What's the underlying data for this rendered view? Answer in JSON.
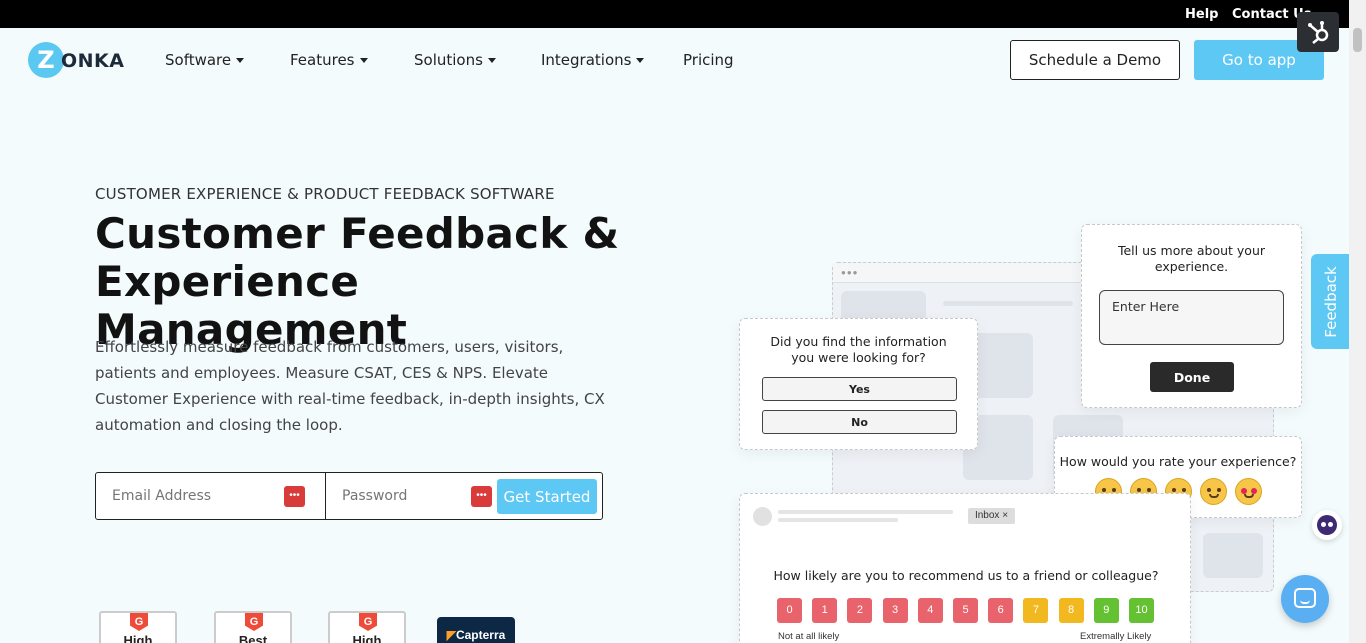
{
  "topbar": {
    "help": "Help",
    "contact": "Contact Us"
  },
  "logo": {
    "mark": "Z",
    "rest": "ONKA"
  },
  "nav": {
    "items": [
      {
        "label": "Software",
        "dropdown": true
      },
      {
        "label": "Features",
        "dropdown": true
      },
      {
        "label": "Solutions",
        "dropdown": true
      },
      {
        "label": "Integrations",
        "dropdown": true
      },
      {
        "label": "Pricing",
        "dropdown": false
      }
    ],
    "demo_button": "Schedule a Demo",
    "app_button": "Go to app"
  },
  "hero": {
    "eyebrow": "CUSTOMER EXPERIENCE & PRODUCT FEEDBACK SOFTWARE",
    "headline": "Customer Feedback & Experience Management",
    "description": "Effortlessly measure feedback from customers, users, visitors, patients and employees. Measure CSAT, CES & NPS. Elevate Customer Experience with real-time feedback, in-depth insights, CX automation and closing the loop."
  },
  "signup": {
    "email_placeholder": "Email Address",
    "password_placeholder": "Password",
    "submit": "Get Started"
  },
  "badges": {
    "b1": "High",
    "b2": "Best",
    "b3": "High",
    "g2_mark": "G",
    "capterra": "Capterra"
  },
  "survey_yesno": {
    "question": "Did you find the information you were looking for?",
    "yes": "Yes",
    "no": "No"
  },
  "survey_text": {
    "question": "Tell us more about your experience.",
    "placeholder": "Enter Here",
    "done": "Done"
  },
  "survey_rating": {
    "question": "How would you rate your experience?"
  },
  "survey_nps": {
    "inbox": "Inbox ×",
    "question": "How likely are you to recommend us to a friend or colleague?",
    "scale": [
      {
        "label": "0",
        "color": "#e8636b"
      },
      {
        "label": "1",
        "color": "#e8636b"
      },
      {
        "label": "2",
        "color": "#e8636b"
      },
      {
        "label": "3",
        "color": "#e8636b"
      },
      {
        "label": "4",
        "color": "#e8636b"
      },
      {
        "label": "5",
        "color": "#e8636b"
      },
      {
        "label": "6",
        "color": "#e8636b"
      },
      {
        "label": "7",
        "color": "#f2b81f"
      },
      {
        "label": "8",
        "color": "#f2b81f"
      },
      {
        "label": "9",
        "color": "#63c132"
      },
      {
        "label": "10",
        "color": "#63c132"
      }
    ],
    "low_label": "Not at all likely",
    "high_label": "Extremally Likely"
  },
  "feedback_tab": "Feedback",
  "colors": {
    "accent": "#5ec8f5",
    "background": "#f3fbfd"
  }
}
